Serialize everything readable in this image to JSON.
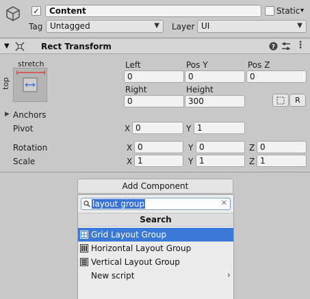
{
  "header": {
    "name_value": "Content",
    "static_label": "Static",
    "tag_label": "Tag",
    "tag_value": "Untagged",
    "layer_label": "Layer",
    "layer_value": "UI"
  },
  "component": {
    "title": "Rect Transform",
    "anchor_horizontal_label": "stretch",
    "anchor_vertical_label": "top",
    "left_label": "Left",
    "left_value": "0",
    "posy_label": "Pos Y",
    "posy_value": "0",
    "posz_label": "Pos Z",
    "posz_value": "0",
    "right_label": "Right",
    "right_value": "0",
    "height_label": "Height",
    "height_value": "300",
    "raw_button": "R",
    "anchors_label": "Anchors",
    "pivot_label": "Pivot",
    "pivot_x": "0",
    "pivot_y": "1",
    "rotation_label": "Rotation",
    "rotation_x": "0",
    "rotation_y": "0",
    "rotation_z": "0",
    "scale_label": "Scale",
    "scale_x": "1",
    "scale_y": "1",
    "scale_z": "1",
    "axis_x": "X",
    "axis_y": "Y",
    "axis_z": "Z"
  },
  "add_component": {
    "button_label": "Add Component",
    "search_value": "layout group",
    "search_header": "Search",
    "items": [
      {
        "label": "Grid Layout Group",
        "icon": "grid-layout-icon"
      },
      {
        "label": "Horizontal Layout Group",
        "icon": "horizontal-layout-icon"
      },
      {
        "label": "Vertical Layout Group",
        "icon": "vertical-layout-icon"
      },
      {
        "label": "New script",
        "icon": "chevron-right-icon"
      }
    ]
  },
  "colors": {
    "selection": "#3a79d8",
    "anchor_red": "#d9443a",
    "anchor_blue": "#3b78d0"
  }
}
